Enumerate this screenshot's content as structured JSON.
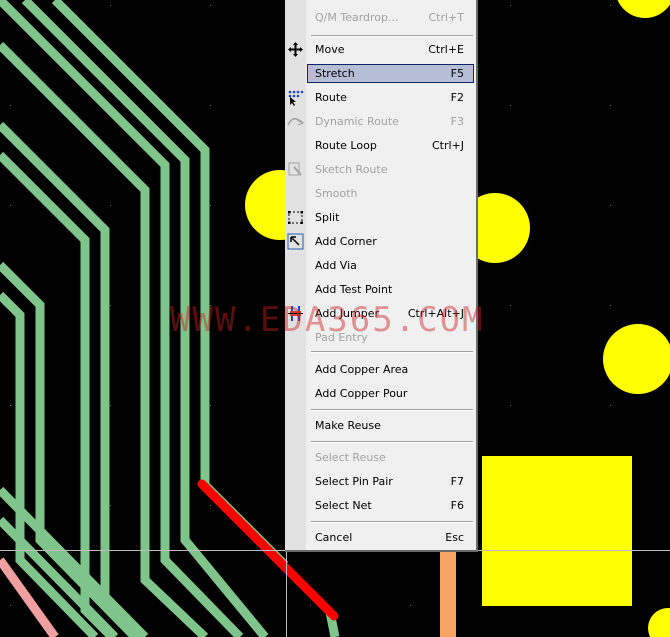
{
  "canvas": {
    "background": "#000000",
    "trace_color": "#7fc48a",
    "pad_color": "#ffff00",
    "selected_trace_color": "#ff0000",
    "orange_trace_color": "#f4a460",
    "pink_trace_color": "#f0a0a0"
  },
  "watermark": "WWW.EDA365.COM",
  "menu": {
    "items": [
      {
        "label": "Q/M Teardrop...",
        "shortcut": "Ctrl+T",
        "disabled": true,
        "icon": ""
      },
      {
        "label": "Move",
        "shortcut": "Ctrl+E",
        "disabled": false,
        "icon": "move-icon"
      },
      {
        "label": "Stretch",
        "shortcut": "F5",
        "disabled": false,
        "highlighted": true,
        "icon": ""
      },
      {
        "label": "Route",
        "shortcut": "F2",
        "disabled": false,
        "icon": "route-icon"
      },
      {
        "label": "Dynamic Route",
        "shortcut": "F3",
        "disabled": true,
        "icon": "dynamic-route-icon"
      },
      {
        "label": "Route Loop",
        "shortcut": "Ctrl+J",
        "disabled": false,
        "icon": ""
      },
      {
        "label": "Sketch Route",
        "shortcut": "",
        "disabled": true,
        "icon": "sketch-route-icon"
      },
      {
        "label": "Smooth",
        "shortcut": "",
        "disabled": true,
        "icon": ""
      },
      {
        "label": "Split",
        "shortcut": "",
        "disabled": false,
        "icon": "split-icon"
      },
      {
        "label": "Add Corner",
        "shortcut": "",
        "disabled": false,
        "icon": "add-corner-icon"
      },
      {
        "label": "Add Via",
        "shortcut": "",
        "disabled": false,
        "icon": ""
      },
      {
        "label": "Add Test Point",
        "shortcut": "",
        "disabled": false,
        "icon": ""
      },
      {
        "label": "Add Jumper",
        "shortcut": "Ctrl+Alt+J",
        "disabled": false,
        "icon": "add-jumper-icon"
      },
      {
        "label": "Pad Entry",
        "shortcut": "",
        "disabled": true,
        "icon": ""
      },
      {
        "label": "Add Copper Area",
        "shortcut": "",
        "disabled": false,
        "icon": ""
      },
      {
        "label": "Add Copper Pour",
        "shortcut": "",
        "disabled": false,
        "icon": ""
      },
      {
        "label": "Make Reuse",
        "shortcut": "",
        "disabled": false,
        "icon": ""
      },
      {
        "label": "Select Reuse",
        "shortcut": "",
        "disabled": true,
        "icon": ""
      },
      {
        "label": "Select Pin Pair",
        "shortcut": "F7",
        "disabled": false,
        "icon": ""
      },
      {
        "label": "Select Net",
        "shortcut": "F6",
        "disabled": false,
        "icon": ""
      },
      {
        "label": "Cancel",
        "shortcut": "Esc",
        "disabled": false,
        "icon": ""
      }
    ]
  }
}
